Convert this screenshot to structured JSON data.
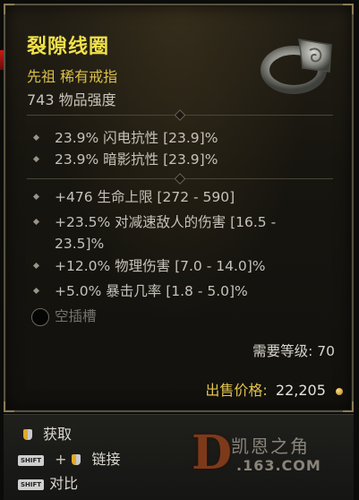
{
  "item": {
    "name": "裂隙线圈",
    "type": "先祖 稀有戒指",
    "power": "743 物品强度"
  },
  "implicit_stats": [
    "23.9% 闪电抗性 [23.9]%",
    "23.9% 暗影抗性 [23.9]%"
  ],
  "affixes": [
    "+476 生命上限 [272 - 590]",
    "+23.5% 对减速敌人的伤害 [16.5 - 23.5]%",
    "+12.0% 物理伤害 [7.0 - 14.0]%",
    "+5.0% 暴击几率 [1.8 - 5.0]%"
  ],
  "socket": {
    "label": "空插槽",
    "icon": "empty-socket-icon"
  },
  "requirements": {
    "level_text": "需要等级: 70"
  },
  "sell": {
    "label": "出售价格:",
    "value": "22,205",
    "icon": "gold-coin-icon"
  },
  "controls": {
    "pickup": "获取",
    "link": "链接",
    "compare": "对比",
    "shift_key": "SHIFT",
    "plus": "+"
  },
  "watermark": {
    "letter": "D",
    "name": "凯恩之角",
    "site": ".163.COM"
  },
  "colors": {
    "title": "#f0e14a",
    "rarity": "#d9c04a",
    "price_label": "#e2c34e",
    "stat_text": "#c6c2ba"
  }
}
